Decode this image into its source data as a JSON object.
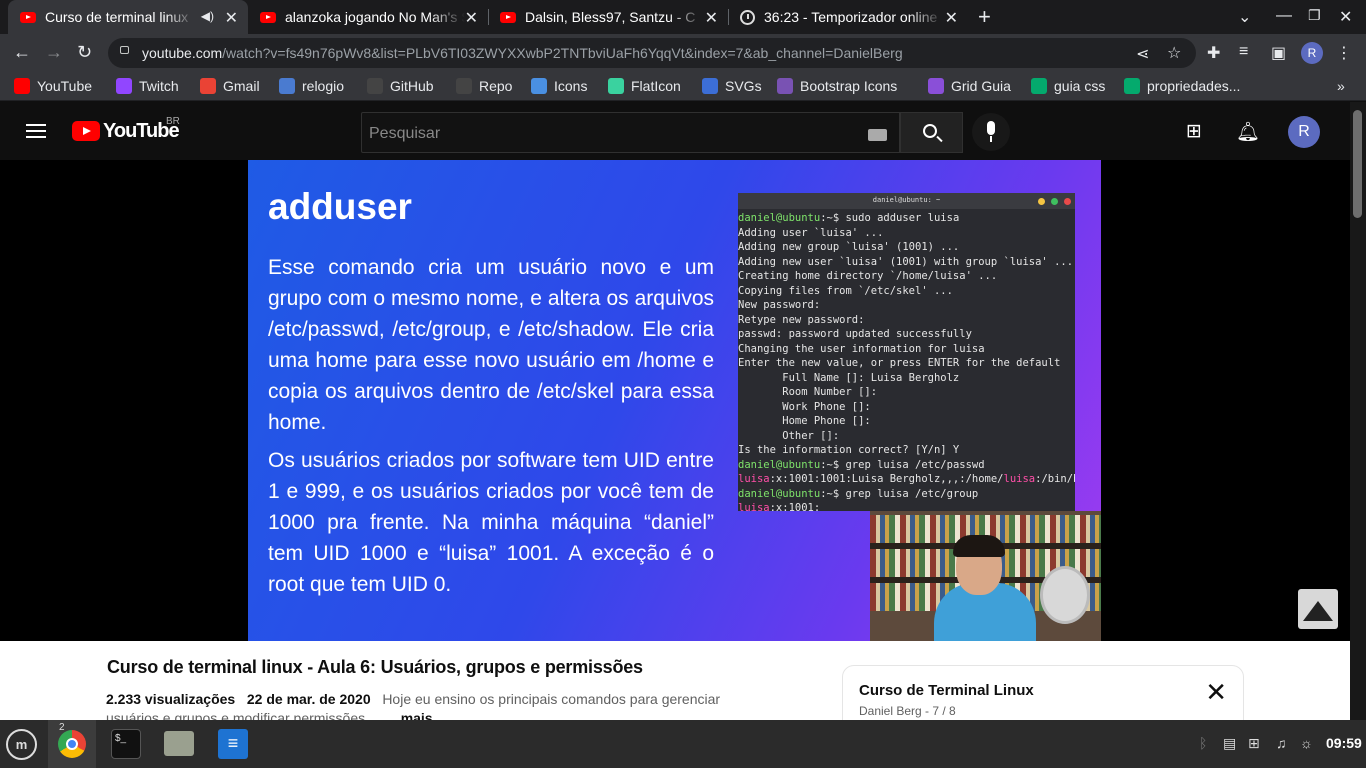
{
  "browser": {
    "tabs": [
      {
        "title": "Curso de terminal linux",
        "icon": "youtube-icon",
        "active": true,
        "audio": true
      },
      {
        "title": "alanzoka jogando No Man's Sky",
        "icon": "youtube-icon"
      },
      {
        "title": "Dalsin, Bless97, Santzu - C",
        "icon": "youtube-icon"
      },
      {
        "title": "36:23 - Temporizador online",
        "icon": "clock-icon"
      }
    ],
    "new_tab": "+",
    "url_host": "youtube.com",
    "url_rest": "/watch?v=fs49n76pWv8&list=PLbV6TI03ZWYXXwbP2TNTbviUaFh6YqqVt&index=7&ab_channel=DanielBerg",
    "profile_initial": "R",
    "bookmarks": [
      {
        "label": "YouTube",
        "icon": "youtube-icon",
        "color": "#ff0000"
      },
      {
        "label": "Twitch",
        "icon": "twitch-icon",
        "color": "#9146ff"
      },
      {
        "label": "Gmail",
        "icon": "gmail-icon",
        "color": "#ea4335"
      },
      {
        "label": "relogio",
        "icon": "clock-icon",
        "color": "#4a7bd0"
      },
      {
        "label": "GitHub",
        "icon": "github-icon",
        "color": "#444444"
      },
      {
        "label": "Repo",
        "icon": "github-icon",
        "color": "#444444"
      },
      {
        "label": "Icons",
        "icon": "flag-icon",
        "color": "#4a90e2"
      },
      {
        "label": "FlatIcon",
        "icon": "flaticon-icon",
        "color": "#3ad29f"
      },
      {
        "label": "SVGs",
        "icon": "svgrepo-icon",
        "color": "#3c6ed6"
      },
      {
        "label": "Bootstrap Icons",
        "icon": "bootstrap-icon",
        "color": "#7952b3"
      },
      {
        "label": "Grid Guia",
        "icon": "shield-icon",
        "color": "#8a4fd8"
      },
      {
        "label": "guia css",
        "icon": "w3-icon",
        "color": "#04aa6d"
      },
      {
        "label": "propriedades...",
        "icon": "w3-icon",
        "color": "#04aa6d"
      }
    ],
    "more_bookmarks": "»"
  },
  "youtube": {
    "logo_text": "YouTube",
    "region": "BR",
    "search_placeholder": "Pesquisar",
    "avatar_initial": "R"
  },
  "slide": {
    "title": "adduser",
    "paragraph1": "Esse comando cria um usuário novo e um grupo com o mesmo nome, e altera os arquivos /etc/passwd, /etc/group, e /etc/shadow. Ele cria uma home para esse novo usuário em /home e copia os arquivos dentro de /etc/skel para essa home.",
    "paragraph2": "Os usuários criados por software tem UID entre 1 e 999, e os usuários criados por você tem de 1000 pra frente. Na minha máquina “daniel” tem UID 1000 e “luisa” 1001. A exceção é o root que tem UID 0.",
    "terminal_title": "daniel@ubuntu: ~",
    "terminal_lines": [
      [
        {
          "t": "daniel@ubuntu",
          "c": "g"
        },
        {
          "t": ":~$ sudo adduser luisa"
        }
      ],
      [
        {
          "t": "Adding user `luisa' ..."
        }
      ],
      [
        {
          "t": "Adding new group `luisa' (1001) ..."
        }
      ],
      [
        {
          "t": "Adding new user `luisa' (1001) with group `luisa' ..."
        }
      ],
      [
        {
          "t": "Creating home directory `/home/luisa' ..."
        }
      ],
      [
        {
          "t": "Copying files from `/etc/skel' ..."
        }
      ],
      [
        {
          "t": "New password:"
        }
      ],
      [
        {
          "t": "Retype new password:"
        }
      ],
      [
        {
          "t": "passwd: password updated successfully"
        }
      ],
      [
        {
          "t": "Changing the user information for luisa"
        }
      ],
      [
        {
          "t": "Enter the new value, or press ENTER for the default"
        }
      ],
      [
        {
          "t": "       Full Name []: Luisa Bergholz"
        }
      ],
      [
        {
          "t": "       Room Number []:"
        }
      ],
      [
        {
          "t": "       Work Phone []:"
        }
      ],
      [
        {
          "t": "       Home Phone []:"
        }
      ],
      [
        {
          "t": "       Other []:"
        }
      ],
      [
        {
          "t": "Is the information correct? [Y/n] Y"
        }
      ],
      [
        {
          "t": "daniel@ubuntu",
          "c": "g"
        },
        {
          "t": ":~$ grep luisa /etc/passwd"
        }
      ],
      [
        {
          "t": "luisa",
          "c": "p"
        },
        {
          "t": ":x:1001:1001:Luisa Bergholz,,,:/home/"
        },
        {
          "t": "luisa",
          "c": "p"
        },
        {
          "t": ":/bin/bash"
        }
      ],
      [
        {
          "t": "daniel@ubuntu",
          "c": "g"
        },
        {
          "t": ":~$ grep luisa /etc/group"
        }
      ],
      [
        {
          "t": "luisa",
          "c": "p"
        },
        {
          "t": ":x:1001:"
        }
      ]
    ]
  },
  "video": {
    "title": "Curso de terminal linux - Aula 6: Usuários, grupos e permissões",
    "views": "2.233 visualizações",
    "date": "22 de mar. de 2020",
    "desc1": "Hoje eu ensino os principais comandos para gerenciar",
    "desc2": "usuários e grupos e modificar permissões...",
    "more": "mais"
  },
  "playlist": {
    "title": "Curso de Terminal Linux",
    "subtitle": "Daniel Berg - 7 / 8"
  },
  "taskbar": {
    "chrome_windows": "2",
    "clock": "09:59"
  }
}
